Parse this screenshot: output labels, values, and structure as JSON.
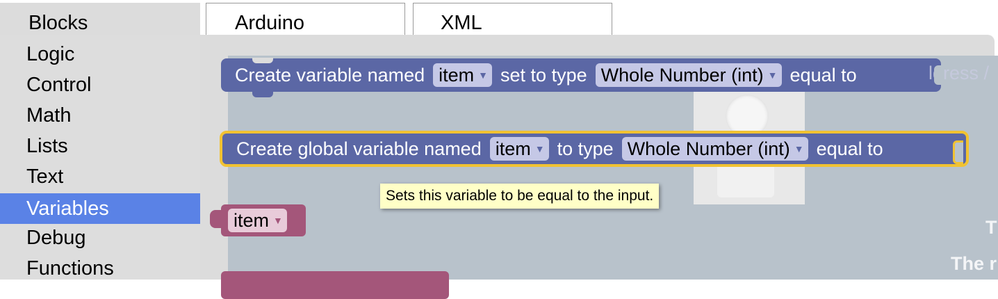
{
  "tabs": [
    {
      "label": "Blocks"
    },
    {
      "label": "Arduino"
    },
    {
      "label": "XML"
    }
  ],
  "categories": [
    {
      "label": "Logic"
    },
    {
      "label": "Control"
    },
    {
      "label": "Math"
    },
    {
      "label": "Lists"
    },
    {
      "label": "Text"
    },
    {
      "label": "Variables"
    },
    {
      "label": "Debug"
    },
    {
      "label": "Functions"
    }
  ],
  "selected_category": "Variables",
  "blocks": {
    "create_var": {
      "text1": "Create variable named",
      "var_name": "item",
      "text2": "set to type",
      "type": "Whole Number (int)",
      "text3": "equal to"
    },
    "create_global": {
      "text1": "Create global variable named",
      "var_name": "item",
      "text2": "to type",
      "type": "Whole Number (int)",
      "text3": "equal to"
    },
    "getter": {
      "var_name": "item"
    }
  },
  "tooltip": "Sets this variable to be equal to the input.",
  "workspace_text": {
    "faded_overlap": "ldress /",
    "right_fragment_1": "T",
    "right_fragment_2": "The r"
  },
  "colors": {
    "variable_block": "#5b67a5",
    "getter_block": "#a4567a",
    "selection_outline": "#f1c232",
    "selected_category": "#5a82e6",
    "tooltip_bg": "#ffffc7"
  },
  "icons": {
    "dropdown": "triangle-down-icon"
  }
}
